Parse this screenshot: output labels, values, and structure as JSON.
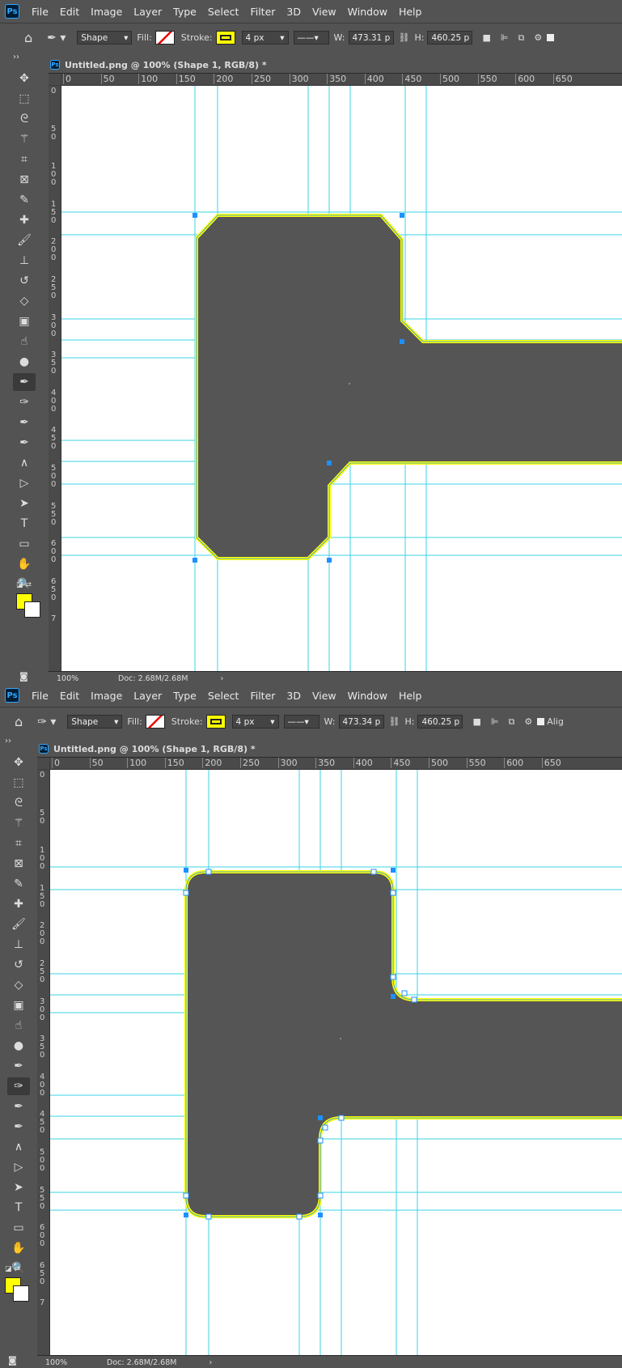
{
  "menus": [
    "File",
    "Edit",
    "Image",
    "Layer",
    "Type",
    "Select",
    "Filter",
    "3D",
    "View",
    "Window",
    "Help"
  ],
  "logo_text": "Ps",
  "options": {
    "mode": "Shape",
    "fill_label": "Fill:",
    "stroke_label": "Stroke:",
    "stroke_size": "4 px",
    "w_label": "W:",
    "h_label": "H:",
    "h_value": "460.25 p",
    "stroke_color": "#ffff00"
  },
  "document": {
    "title": "Untitled.png @ 100% (Shape 1, RGB/8) *"
  },
  "status": {
    "zoom": "100%",
    "doc_size": "Doc: 2.68M/2.68M"
  },
  "ruler": {
    "h_labels": [
      "0",
      "50",
      "100",
      "150",
      "200",
      "250",
      "300",
      "350",
      "400",
      "450",
      "500",
      "550",
      "600",
      "650"
    ],
    "v_labels": [
      "0",
      "5 0",
      "1 0 0",
      "1 5 0",
      "2 0 0",
      "2 5 0",
      "3 0 0",
      "3 5 0",
      "4 0 0",
      "4 5 0",
      "5 0 0",
      "5 5 0",
      "6 0 0",
      "6 5 0",
      "7"
    ]
  },
  "screens": [
    {
      "w_value": "473.31 p",
      "active_tool": "pen-tool",
      "corner_style": "chamfer"
    },
    {
      "w_value": "473.34 p",
      "active_tool": "curvature-pen-tool",
      "corner_style": "rounded",
      "extra_label": "Alig"
    }
  ],
  "colors": {
    "ui_bg": "#535353",
    "guide": "#3ad3e6",
    "shape_fill": "#555555",
    "stroke": "#ffff00",
    "foreground": "#ffff00",
    "background": "#ffffff"
  },
  "tools": [
    "move-icon",
    "marquee-icon",
    "lasso-icon",
    "magic-wand-icon",
    "crop-icon",
    "frame-icon",
    "eyedropper-icon",
    "healing-brush-icon",
    "brush-icon",
    "stamp-icon",
    "history-brush-icon",
    "eraser-icon",
    "gradient-icon",
    "smudge-icon",
    "dodge-icon",
    "pen-icon",
    "curvature-pen-icon",
    "add-anchor-icon",
    "convert-point-icon",
    "direct-select-icon",
    "path-select-icon",
    "type-icon",
    "rectangle-icon",
    "hand-icon",
    "zoom-icon"
  ]
}
